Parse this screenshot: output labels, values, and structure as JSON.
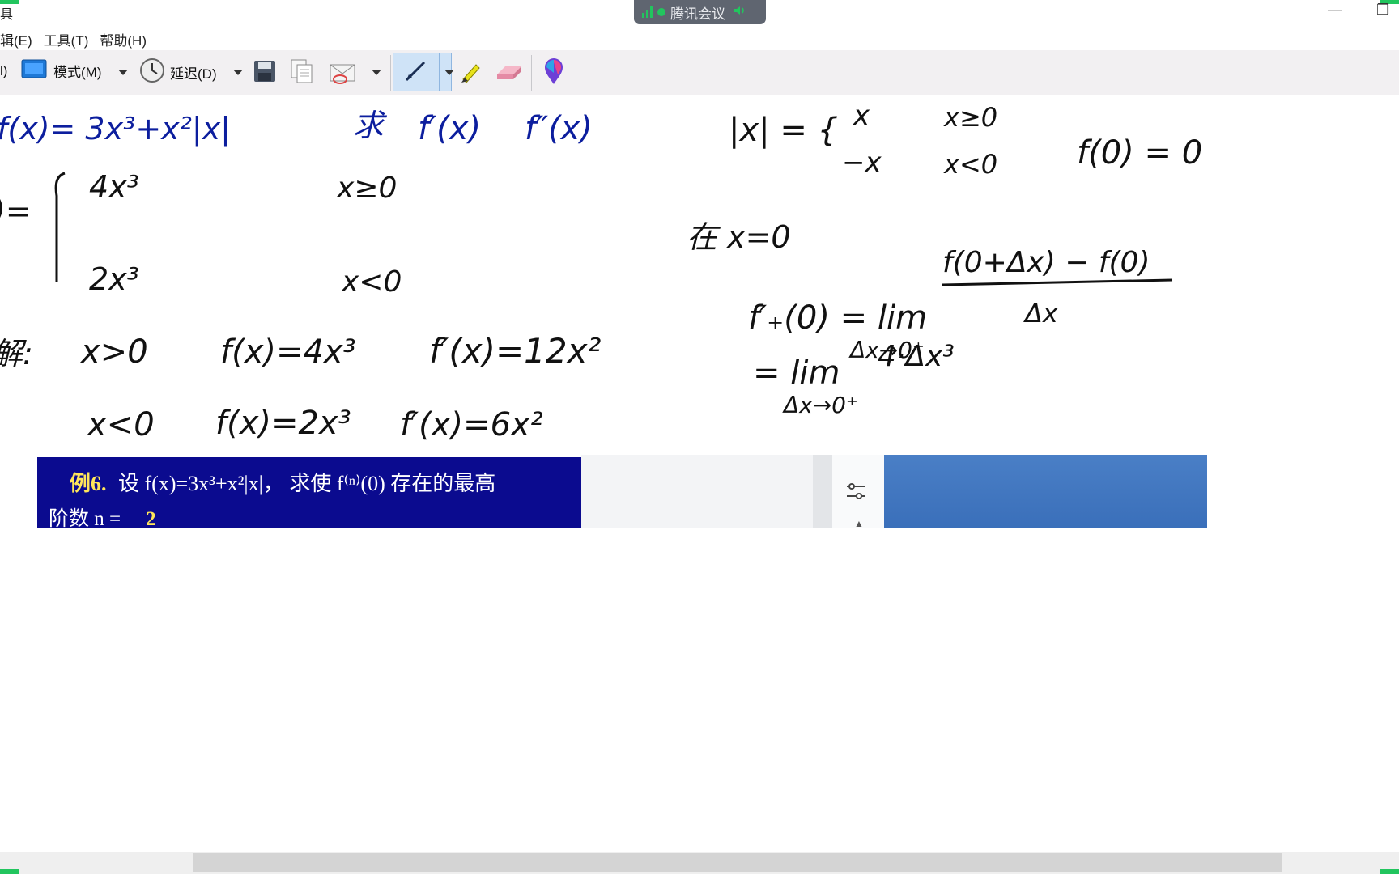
{
  "window": {
    "title_fragment": "具",
    "minimize": "—",
    "restore": "❐"
  },
  "meeting_bar": {
    "label": "腾讯会议",
    "colors": {
      "bar": "#5f6570",
      "indicator": "#22c55e"
    },
    "icons": [
      "signal-icon",
      "status-dot-icon",
      "speaker-icon"
    ]
  },
  "menu": {
    "items": [
      "辑(E)",
      "工具(T)",
      "帮助(H)"
    ]
  },
  "toolbar": {
    "left_fragment": "l)",
    "mode_label": "模式(M)",
    "delay_label": "延迟(D)",
    "icons": [
      "mode-icon",
      "clock-icon",
      "save-icon",
      "copy-icon",
      "send-icon",
      "pen-icon",
      "highlighter-icon",
      "eraser-icon",
      "color-picker-icon"
    ]
  },
  "handwriting": {
    "ink_colors": {
      "blue": "#0c1e9e",
      "black": "#111111"
    },
    "line1_blue": [
      "f(x)= 3x³+x²|x|",
      "求",
      "f′(x)",
      "f″(x)"
    ],
    "abs_def": [
      "|x| = {",
      "x",
      "x≥0",
      "−x",
      "x<0",
      "f(0) = 0"
    ],
    "piece": [
      ")=",
      "4x³",
      "x≥0",
      "2x³",
      "x<0"
    ],
    "solution": [
      "解:",
      "x>0",
      "f(x)=4x³",
      "f′(x)=12x²",
      "x<0",
      "f(x)=2x³",
      "f′(x)=6x²"
    ],
    "derivative_at_zero": [
      "在 x=0",
      "f′₊(0) = lim",
      "Δx→0⁺",
      "f(0+Δx) − f(0)",
      "Δx",
      "= lim",
      "Δx→0⁺",
      "4·Δx³"
    ]
  },
  "slide": {
    "example_label": "例6.",
    "line1": "设 f(x)=3x³+x²|x|， 求使 f⁽ⁿ⁾(0) 存在的最高",
    "line2_prefix": "阶数 n =",
    "answer": "2",
    "colors": {
      "background": "#0b0b8f",
      "highlight": "#ffe65a"
    }
  },
  "side_panel": {
    "icons": [
      "settings-sliders-icon",
      "chevron-up-icon"
    ]
  }
}
